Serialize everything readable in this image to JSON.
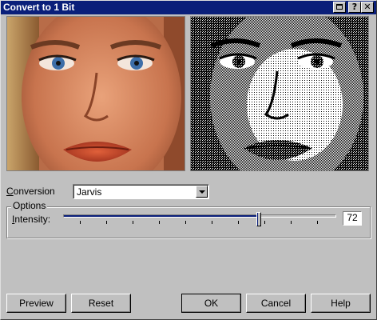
{
  "window": {
    "title": "Convert to 1 Bit",
    "controls": {
      "maximize_icon": "maximize-icon",
      "help_label": "?",
      "close_label": "✕"
    }
  },
  "previews": {
    "original_label": "original-preview-image",
    "result_label": "dithered-preview-image"
  },
  "conversion": {
    "label_accel": "C",
    "label_rest": "onversion",
    "selected": "Jarvis"
  },
  "options": {
    "group_title": "Options",
    "intensity_label_accel": "I",
    "intensity_label_rest": "ntensity:",
    "intensity_value": "72",
    "intensity_min": 0,
    "intensity_max": 100
  },
  "buttons": {
    "preview": "Preview",
    "reset": "Reset",
    "ok": "OK",
    "cancel": "Cancel",
    "help": "Help"
  },
  "colors": {
    "face": "#c0c0c0",
    "titlebar": "#0a1f7a",
    "accent": "#0a1f7a"
  }
}
